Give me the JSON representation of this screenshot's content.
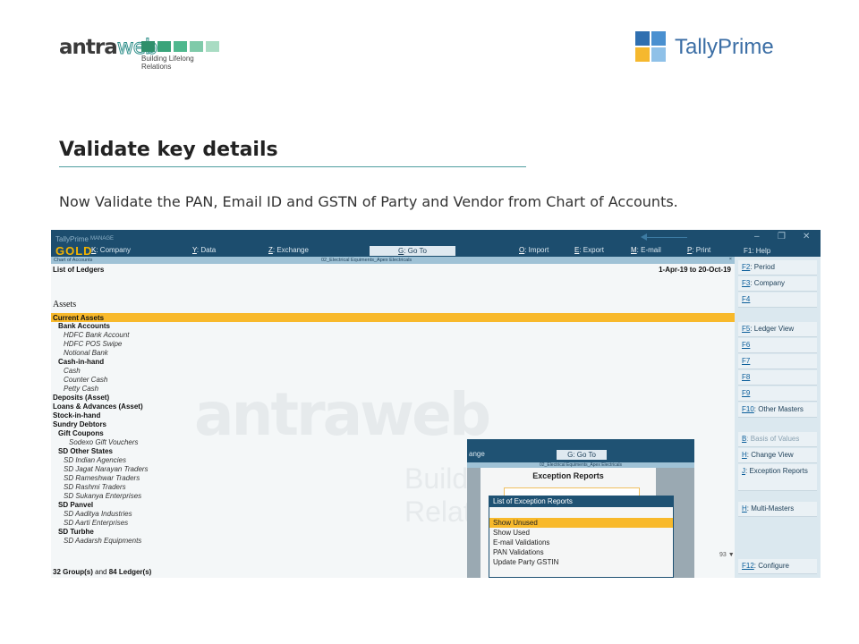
{
  "brand": {
    "left_name_a": "antra",
    "left_name_b": "web",
    "left_tagline": "Building Lifelong Relations",
    "left_square_colors": [
      "#2f8f6b",
      "#3aa47a",
      "#4fb88e",
      "#7fcaa9",
      "#a9dcc3"
    ],
    "right_name": "TallyPrime"
  },
  "heading": "Validate key details",
  "description": "Now Validate the PAN, Email ID and GSTN of Party and Vendor from Chart of Accounts.",
  "tally": {
    "product": "TallyPrime",
    "mode": "MANAGE",
    "edition": "GOLD",
    "menu": [
      {
        "key": "K",
        "label": ": Company"
      },
      {
        "key": "Y",
        "label": ": Data"
      },
      {
        "key": "Z",
        "label": ": Exchange"
      },
      {
        "key": "O",
        "label": ": Import"
      },
      {
        "key": "E",
        "label": ": Export"
      },
      {
        "key": "M",
        "label": ": E-mail"
      },
      {
        "key": "P",
        "label": ": Print"
      }
    ],
    "goto": {
      "key": "G",
      "label": ": Go To"
    },
    "help": "F1: Help",
    "window_controls": [
      "–",
      "❐",
      "✕"
    ],
    "breadcrumb": "Chart of Accounts",
    "company": "02_Electrical Equiments_Apex Electricals",
    "close": "×",
    "list_title": "List of Ledgers",
    "period": "1-Apr-19 to 20-Oct-19",
    "section": "Assets",
    "highlight_group": "Current Assets",
    "rows": [
      {
        "text": "Bank Accounts",
        "type": "g",
        "indent": 1
      },
      {
        "text": "HDFC Bank Account",
        "type": "l",
        "indent": 2
      },
      {
        "text": "HDFC POS Swipe",
        "type": "l",
        "indent": 2
      },
      {
        "text": "Notional Bank",
        "type": "l",
        "indent": 2
      },
      {
        "text": "Cash-in-hand",
        "type": "g",
        "indent": 1
      },
      {
        "text": "Cash",
        "type": "l",
        "indent": 2
      },
      {
        "text": "Counter Cash",
        "type": "l",
        "indent": 2
      },
      {
        "text": "Petty Cash",
        "type": "l",
        "indent": 2
      },
      {
        "text": "Deposits (Asset)",
        "type": "g",
        "indent": 0
      },
      {
        "text": "Loans & Advances (Asset)",
        "type": "g",
        "indent": 0
      },
      {
        "text": "Stock-in-hand",
        "type": "g",
        "indent": 0
      },
      {
        "text": "Sundry Debtors",
        "type": "g",
        "indent": 0
      },
      {
        "text": "Gift Coupons",
        "type": "g",
        "indent": 1
      },
      {
        "text": "Sodexo Gift Vouchers",
        "type": "l",
        "indent": 3
      },
      {
        "text": "SD Other States",
        "type": "g",
        "indent": 1
      },
      {
        "text": "SD Indian Agencies",
        "type": "l",
        "indent": 2
      },
      {
        "text": "SD Jagat Narayan Traders",
        "type": "l",
        "indent": 2
      },
      {
        "text": "SD Rameshwar Traders",
        "type": "l",
        "indent": 2
      },
      {
        "text": "SD Rashmi Traders",
        "type": "l",
        "indent": 2
      },
      {
        "text": "SD Sukanya Enterprises",
        "type": "l",
        "indent": 2
      },
      {
        "text": "SD Panvel",
        "type": "g",
        "indent": 1
      },
      {
        "text": "SD Aaditya Industries",
        "type": "l",
        "indent": 2
      },
      {
        "text": "SD Aarti Enterprises",
        "type": "l",
        "indent": 2
      },
      {
        "text": "SD Turbhe",
        "type": "g",
        "indent": 1
      },
      {
        "text": "SD Aadarsh Equipments",
        "type": "l",
        "indent": 2
      }
    ],
    "footer_groups": "32 Group(s)",
    "footer_and": "and",
    "footer_ledgers": "84 Ledger(s)",
    "scroll_count": "93 ▼",
    "watermark": "antraweb",
    "watermark_tag": "Building Lifelong Relations",
    "side_buttons": [
      {
        "key": "F2",
        "label": ": Period",
        "dim": false
      },
      {
        "key": "F3",
        "label": ": Company",
        "dim": false
      },
      {
        "key": "F4",
        "label": "",
        "dim": true
      },
      {
        "key": "F5",
        "label": ": Ledger View",
        "dim": false
      },
      {
        "key": "F6",
        "label": "",
        "dim": true
      },
      {
        "key": "F7",
        "label": "",
        "dim": true
      },
      {
        "key": "F8",
        "label": "",
        "dim": true
      },
      {
        "key": "F9",
        "label": "",
        "dim": true
      },
      {
        "key": "F10",
        "label": ": Other Masters",
        "dim": false
      },
      {
        "key": "B",
        "label": ": Basis of Values",
        "dim": true
      },
      {
        "key": "H",
        "label": ": Change View",
        "dim": false
      },
      {
        "key": "J",
        "label": ": Exception Reports",
        "dim": false
      },
      {
        "key": "H",
        "label": ": Multi-Masters",
        "dim": false
      },
      {
        "key": "F12",
        "label": ": Configure",
        "dim": false
      }
    ]
  },
  "popup": {
    "bg_text": "ange",
    "goto": "G: Go To",
    "company": "02_Electrical Equiments_Apex Electricals",
    "title": "Exception Reports",
    "list_title": "List of Exception Reports",
    "items": [
      "Show Unused",
      "Show Used",
      "E-mail Validations",
      "PAN Validations",
      "Update Party GSTIN"
    ],
    "selected_index": 0
  }
}
